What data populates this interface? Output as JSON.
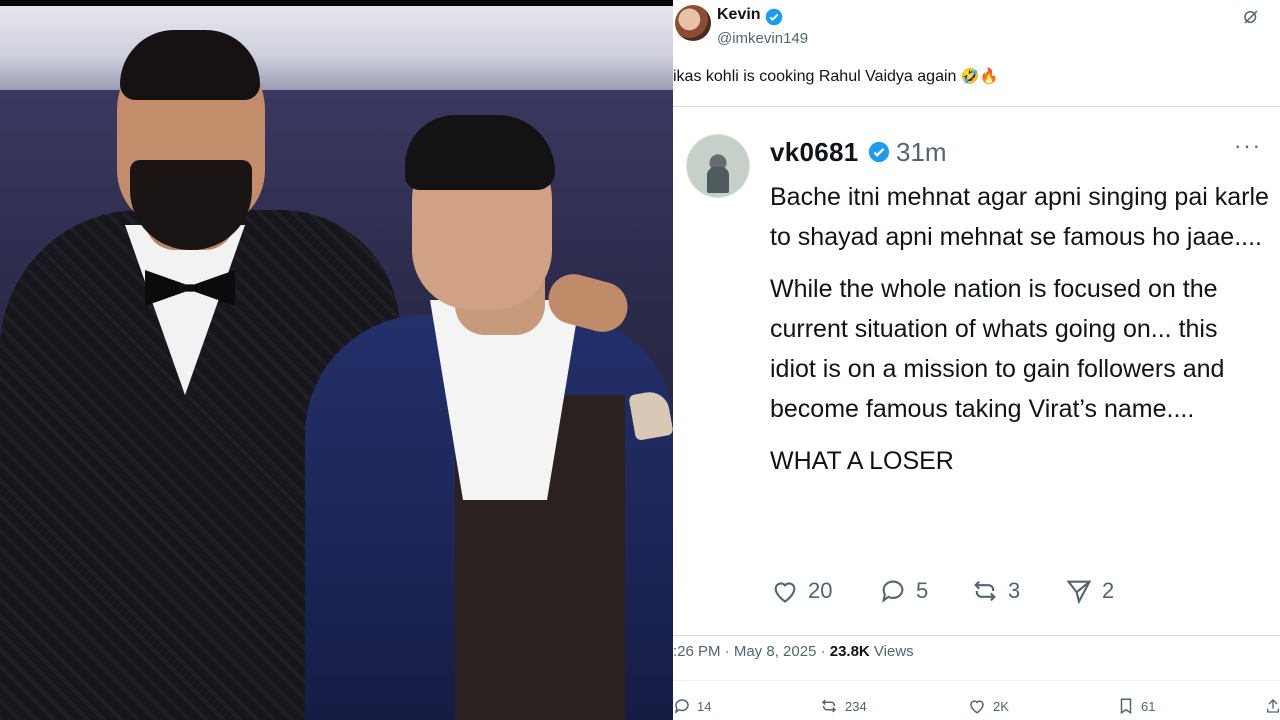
{
  "tweet": {
    "author_name": "Kevin",
    "author_handle": "@imkevin149",
    "text": "ikas kohli is cooking Rahul Vaidya again",
    "emoji": "🤣🔥",
    "quoted": {
      "author": "vk0681",
      "time": "31m",
      "more": "···",
      "body": [
        "Bache itni mehnat agar apni singing pai karle to shayad apni mehnat se famous ho jaae....",
        "While the whole nation is focused on the current situation of whats going on... this idiot is on a mission to gain followers and become famous taking Virat’s name....",
        "WHAT A LOSER"
      ],
      "likes": "20",
      "replies": "5",
      "reposts": "3",
      "shares": "2"
    },
    "timestamp": ":26 PM · May 8, 2025 · ",
    "views_count": "23.8K",
    "views_label": " Views",
    "stats": {
      "replies": "14",
      "reposts": "234",
      "likes": "2K",
      "bookmarks": "61"
    }
  },
  "colors": {
    "verified_blue": "#1d9bf0",
    "text_primary": "#0f1419",
    "text_secondary": "#536471"
  }
}
